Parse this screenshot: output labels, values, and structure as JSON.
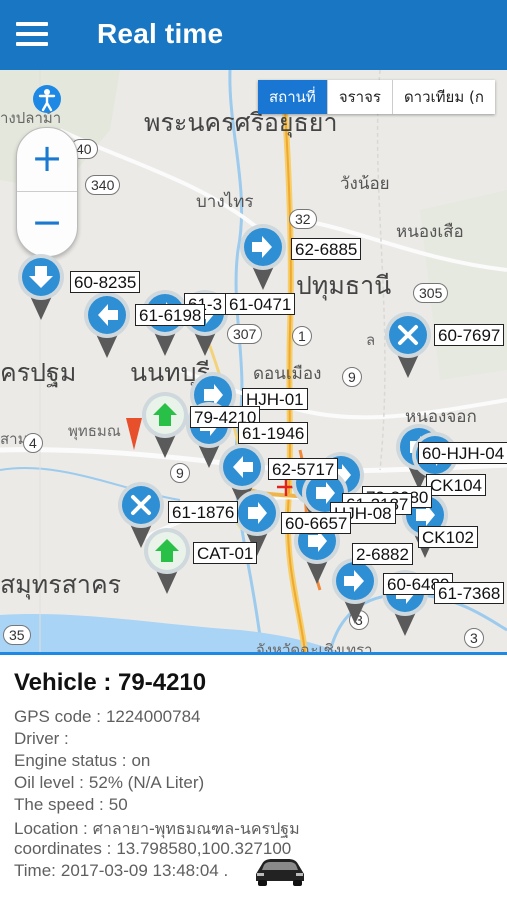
{
  "app": {
    "title": "Real time"
  },
  "map": {
    "map_types": [
      {
        "label": "สถานที่",
        "active": true
      },
      {
        "label": "จราจร",
        "active": false
      },
      {
        "label": "ดาวเทียม (ก",
        "active": false
      }
    ],
    "zoom": {
      "in_label": "+",
      "out_label": "−"
    },
    "labels": {
      "ayutthaya": "พระนครศรีอยุธยา",
      "pathum_thani": "ปทุมธานี",
      "nonthaburi": "นนทบุรี",
      "nakhon_pathom": "ครปฐม",
      "samut_sakhon": "สมุทรสาคร",
      "bang_pla_ma": "างปลาม้า",
      "bang_sai": "บางไทร",
      "wang_noi": "วังน้อย",
      "nong_suea": "หนองเสือ",
      "don_mueang": "ดอนเมือง",
      "nong_chok": "หนองจอก",
      "phutthamonthon": "พุทธมณ",
      "chachoengsao": "จังหวัดฉะเชิงเทรา",
      "sam": "สาม",
      "lo": "ล"
    },
    "routes": [
      "40",
      "340",
      "32",
      "305",
      "307",
      "1",
      "9",
      "4",
      "9",
      "35",
      "3",
      "3"
    ],
    "vehicles": [
      {
        "label": "62-6885",
        "color": "#2f8fd4",
        "icon": "arrow-right"
      },
      {
        "label": "60-8235",
        "color": "#2f8fd4",
        "icon": "arrow-down"
      },
      {
        "label": "61-3",
        "color": "#2f8fd4",
        "icon": "arrow"
      },
      {
        "label": "61-0471",
        "color": "#2f8fd4",
        "icon": "arrow"
      },
      {
        "label": "61-6198",
        "color": "#2f8fd4",
        "icon": "arrow-left"
      },
      {
        "label": "60-7697",
        "color": "#2f8fd4",
        "icon": "stop-x"
      },
      {
        "label": "HJH-01",
        "color": "#2f8fd4",
        "icon": "arrow"
      },
      {
        "label": "79-4210",
        "color": "#2f8fd4",
        "icon": "arrow-up"
      },
      {
        "label": "61-1946",
        "color": "#2f8fd4",
        "icon": "arrow"
      },
      {
        "label": "60-HJH-04",
        "color": "#2f8fd4",
        "icon": "arrow"
      },
      {
        "label": "62-5717",
        "color": "#2f8fd4",
        "icon": "arrow-left"
      },
      {
        "label": "CK104",
        "color": "#2f8fd4",
        "icon": "arrow"
      },
      {
        "label": "79-8080",
        "color": "#2f8fd4",
        "icon": "arrow"
      },
      {
        "label": "61-1876",
        "color": "#2f8fd4",
        "icon": "stop-x"
      },
      {
        "label": "61-2187",
        "color": "#2f8fd4",
        "icon": "arrow"
      },
      {
        "label": "HJH-08",
        "color": "#2f8fd4",
        "icon": "arrow"
      },
      {
        "label": "60-6657",
        "color": "#2f8fd4",
        "icon": "arrow"
      },
      {
        "label": "CK102",
        "color": "#2f8fd4",
        "icon": "arrow"
      },
      {
        "label": "CAT-01",
        "color": "#2f8fd4",
        "icon": "arrow-up"
      },
      {
        "label": "2-6882",
        "color": "#2f8fd4",
        "icon": "arrow"
      },
      {
        "label": "60-6480",
        "color": "#2f8fd4",
        "icon": "arrow-right"
      },
      {
        "label": "61-7368",
        "color": "#2f8fd4",
        "icon": "arrow"
      }
    ]
  },
  "vehicle": {
    "title": "Vehicle : 79-4210",
    "fields": [
      {
        "label": "GPS code :",
        "value": "1224000784"
      },
      {
        "label": "Driver :",
        "value": ""
      },
      {
        "label": "Engine status :",
        "value": "on"
      },
      {
        "label": "Oil level :",
        "value": "52% (N/A Liter)"
      },
      {
        "label": "The speed :",
        "value": "50"
      },
      {
        "label": "Location :",
        "value": "ศาลายา-พุทธมณฑล-นครปฐม"
      },
      {
        "label": "coordinates :",
        "value": "13.798580,100.327100"
      },
      {
        "label": "Time:",
        "value": "2017-03-09 13:48:04 ."
      }
    ],
    "car_icon": "car-icon"
  },
  "colors": {
    "header": "#1976c2",
    "accent": "#1e88e5",
    "marker": "#2f8fd4"
  }
}
